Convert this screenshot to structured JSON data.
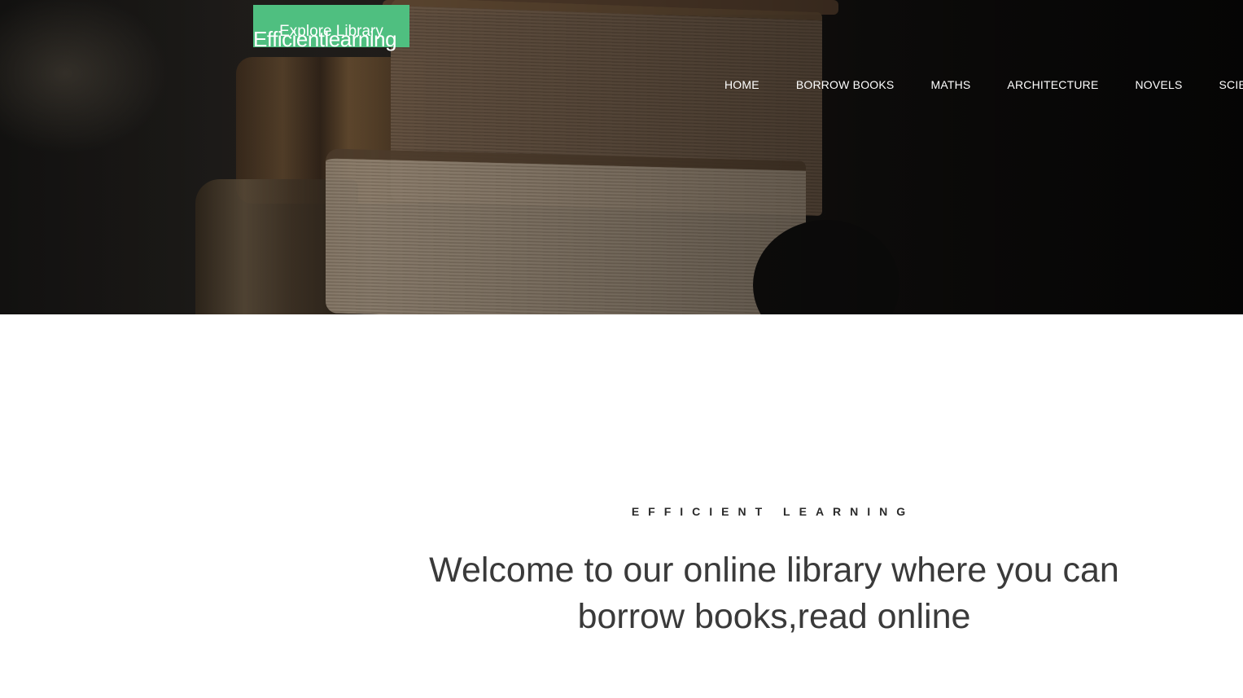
{
  "header": {
    "explore_button": "Explore Library",
    "brand": "Efficientlearning",
    "nav": [
      "HOME",
      "BORROW BOOKS",
      "MATHS",
      "ARCHITECTURE",
      "NOVELS",
      "SCIENCE"
    ]
  },
  "intro": {
    "eyebrow": "EFFICIENT LEARNING",
    "headline": "Welcome to our online library where you can borrow books,read online"
  },
  "colors": {
    "accent": "#4fbf80",
    "hero_bg": "#1b1a18",
    "text_dark": "#3a3a3a"
  }
}
